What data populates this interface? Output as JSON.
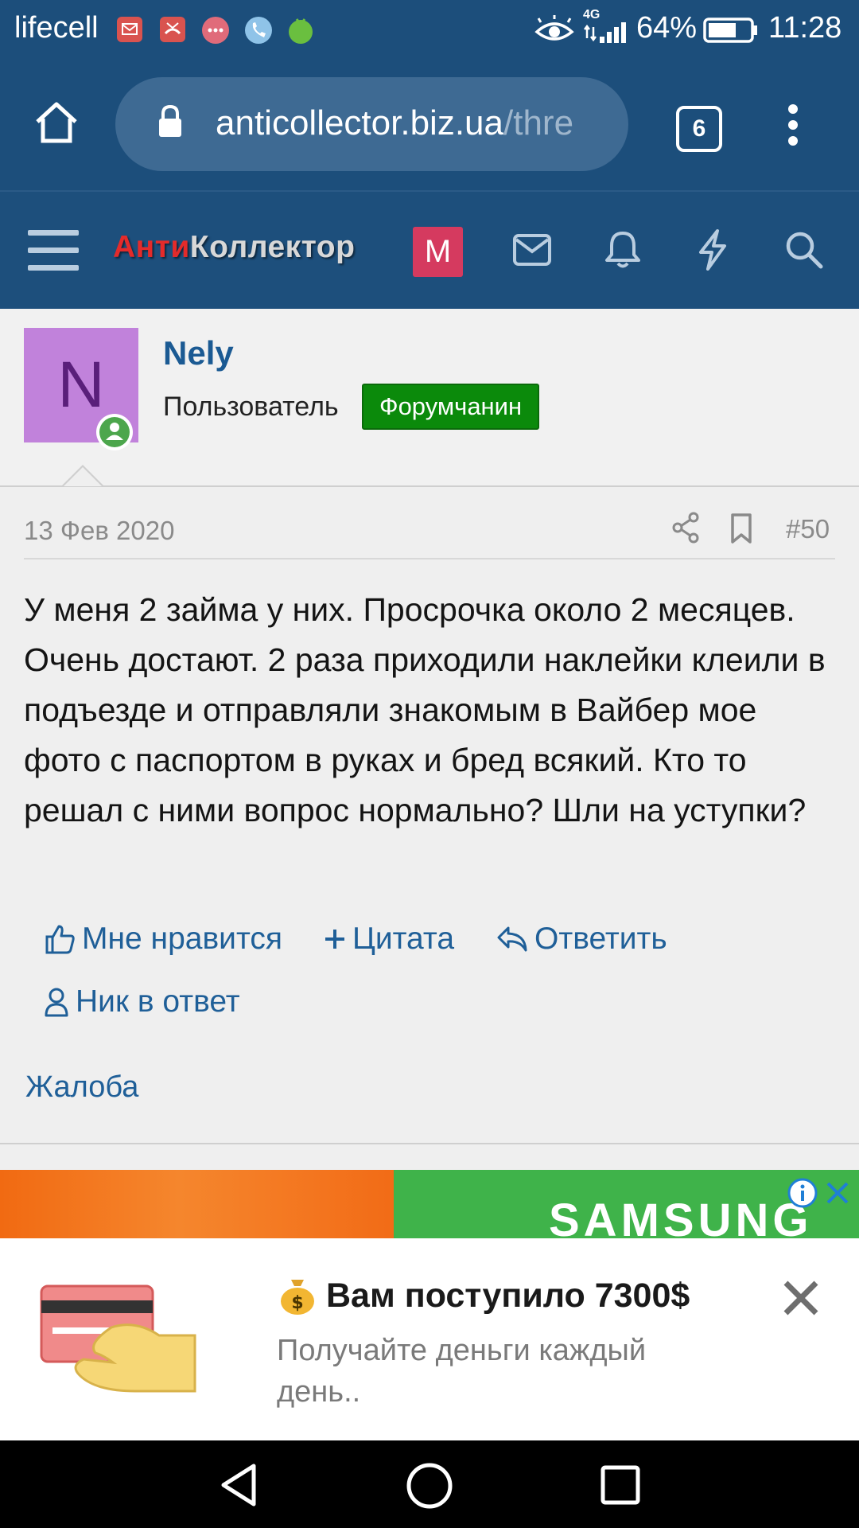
{
  "status_bar": {
    "carrier": "lifecell",
    "network": "4G",
    "battery": "64%",
    "time": "11:28",
    "icons": [
      "mail-notification-icon",
      "missed-call-icon",
      "message-bubble-icon",
      "phone-icon",
      "android-icon",
      "eye-icon",
      "signal-icon",
      "battery-icon"
    ]
  },
  "browser": {
    "url_host": "anticollector.biz.ua",
    "url_rest": "/thre",
    "tab_count": "6"
  },
  "site_nav": {
    "logo_part1": "Анти",
    "logo_part2": "Коллектор",
    "account_initial": "M"
  },
  "post": {
    "avatar_letter": "N",
    "username": "Nely",
    "role": "Пользователь",
    "badge": "Форумчанин",
    "date": "13 Фев 2020",
    "number": "#50",
    "text": "У меня 2 займа у них. Просрочка около 2 месяцев. Очень достают. 2 раза приходили наклейки клеили в подъезде и отправляли знакомым в Вайбер мое фото с паспортом в руках и бред всякий. Кто то решал с ними вопрос нормально? Шли на уступки?",
    "actions": {
      "like": "Мне нравится",
      "quote": "Цитата",
      "reply": "Ответить",
      "nick": "Ник в ответ"
    },
    "complaint": "Жалоба"
  },
  "ad": {
    "brand": "SAMSUNG",
    "title": "Вам поступило 7300$",
    "subtitle": "Получайте деньги каждый день.."
  },
  "colors": {
    "header_blue": "#1c4e7b",
    "link_blue": "#1f5f98",
    "badge_green": "#0b8a0b",
    "avatar_purple": "#c182db",
    "account_pink": "#d53a5f"
  }
}
